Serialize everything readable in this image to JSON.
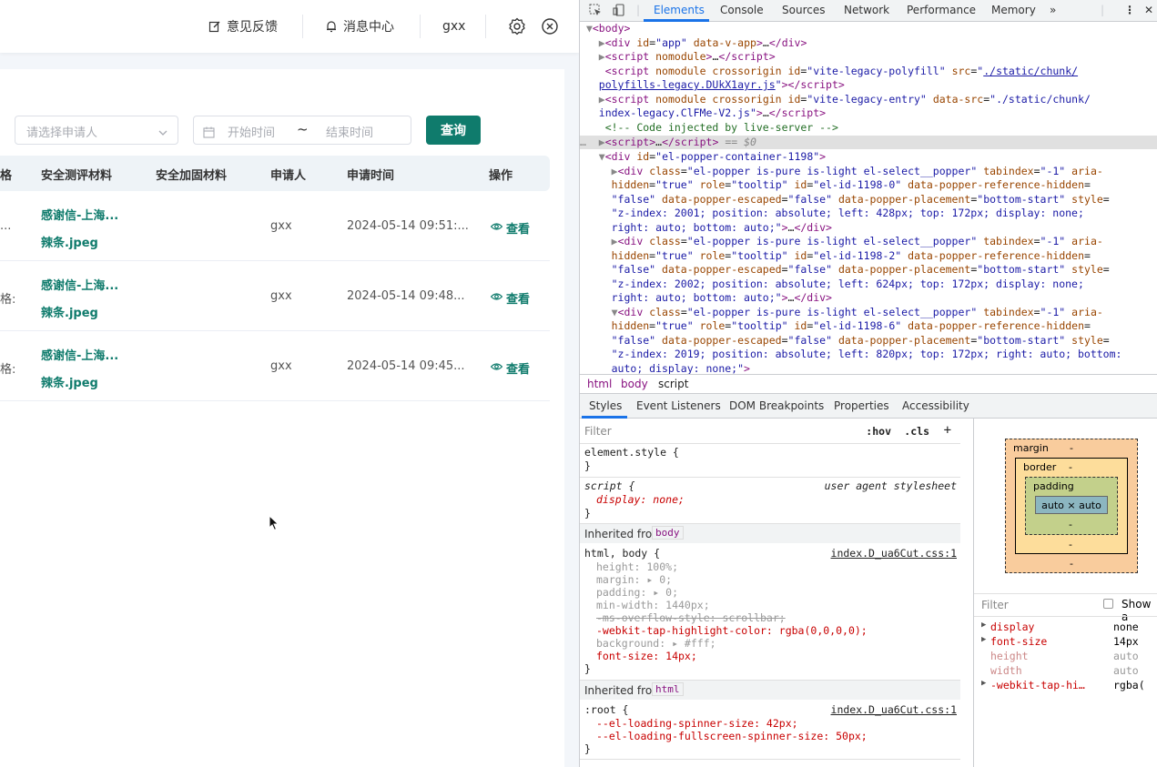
{
  "app": {
    "header": {
      "feedback": "意见反馈",
      "messages": "消息中心",
      "user": "gxx"
    },
    "filters": {
      "applicant_placeholder": "请选择申请人",
      "start_placeholder": "开始时间",
      "range_sep": "~",
      "end_placeholder": "结束时间",
      "query_label": "查询"
    },
    "table": {
      "columns": [
        "格",
        "安全测评材料",
        "安全加固材料",
        "申请人",
        "申请时间",
        "操作"
      ],
      "rows": [
        {
          "col0": "...",
          "file_line1": "感谢信-上海...",
          "file_line2": "辣条.jpeg",
          "applicant": "gxx",
          "time": "2024-05-14 09:51:...",
          "action": "查看"
        },
        {
          "col0": "格:",
          "file_line1": "感谢信-上海...",
          "file_line2": "辣条.jpeg",
          "applicant": "gxx",
          "time": "2024-05-14 09:48...",
          "action": "查看"
        },
        {
          "col0": "格:",
          "file_line1": "感谢信-上海...",
          "file_line2": "辣条.jpeg",
          "applicant": "gxx",
          "time": "2024-05-14 09:45...",
          "action": "查看"
        }
      ]
    }
  },
  "devtools": {
    "tabs": [
      "Elements",
      "Console",
      "Sources",
      "Network",
      "Performance",
      "Memory",
      "»"
    ],
    "active_tab": "Elements",
    "breadcrumbs": [
      "html",
      "body",
      "script"
    ],
    "sub_tabs": [
      "Styles",
      "Event Listeners",
      "DOM Breakpoints",
      "Properties",
      "Accessibility"
    ],
    "styles": {
      "filter_placeholder": "Filter",
      "hov": ":hov",
      "cls": ".cls",
      "element_style": "element.style {",
      "script_selector": "script {",
      "ua_label": "user agent stylesheet",
      "display_decl": "display: none;",
      "inherited_from": "Inherited from",
      "body_chip": "body",
      "html_chip": "html",
      "html_body_selector": "html, body {",
      "source1": "index.D_ua6Cut.css:1",
      "root_selector": ":root {",
      "decls_body": [
        "height: 100%;",
        "margin: ▸ 0;",
        "padding: ▸ 0;",
        "min-width: 1440px;",
        "-ms-overflow-style: scrollbar;",
        "-webkit-tap-highlight-color: rgba(0,0,0,0);",
        "background: ▸ #fff;",
        "font-size: 14px;"
      ],
      "decls_root": [
        "--el-loading-spinner-size: 42px;",
        "--el-loading-fullscreen-spinner-size: 50px;"
      ]
    },
    "box_model": {
      "margin": "margin",
      "border": "border",
      "padding": "padding",
      "content": "auto × auto",
      "dash": "-"
    },
    "computed": {
      "filter_placeholder": "Filter",
      "show_all": "Show a",
      "props": [
        {
          "name": "display",
          "value": "none"
        },
        {
          "name": "font-size",
          "value": "14px"
        },
        {
          "name": "height",
          "value": "auto"
        },
        {
          "name": "width",
          "value": "auto"
        },
        {
          "name": "-webkit-tap-hi…",
          "value": "rgba("
        }
      ]
    }
  }
}
